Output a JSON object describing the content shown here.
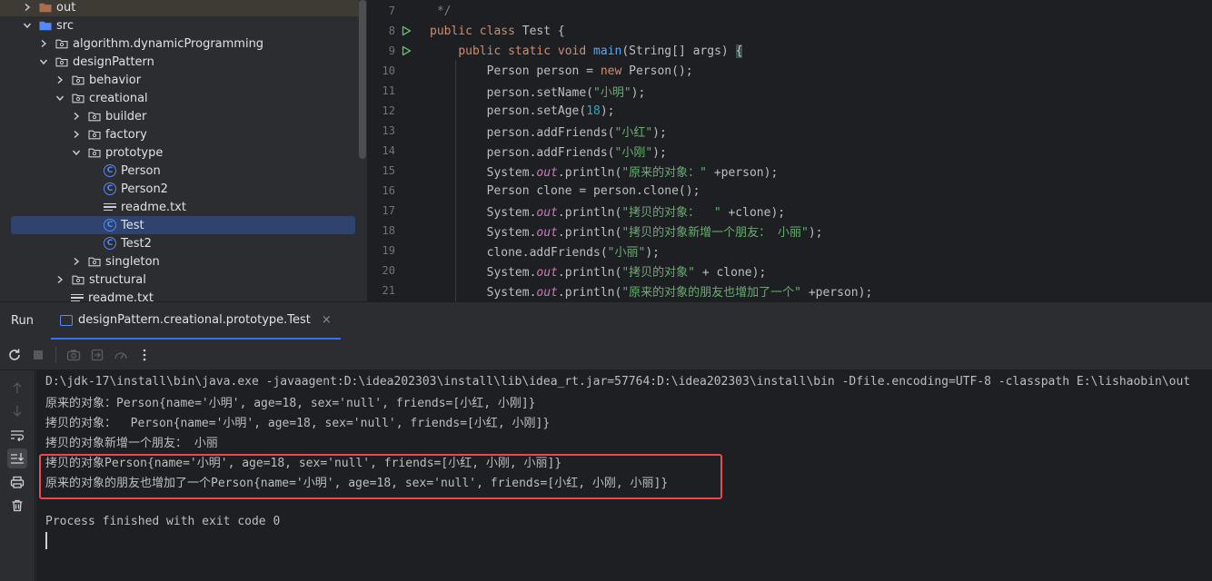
{
  "tree": {
    "items": [
      {
        "label": "out",
        "kind": "folder-brown",
        "expand": "collapsed",
        "depth": 1
      },
      {
        "label": "src",
        "kind": "folder-blue",
        "expand": "expanded",
        "depth": 1
      },
      {
        "label": "algorithm.dynamicProgramming",
        "kind": "package",
        "expand": "collapsed",
        "depth": 2
      },
      {
        "label": "designPattern",
        "kind": "package",
        "expand": "expanded",
        "depth": 2
      },
      {
        "label": "behavior",
        "kind": "package",
        "expand": "collapsed",
        "depth": 3
      },
      {
        "label": "creational",
        "kind": "package",
        "expand": "expanded",
        "depth": 3
      },
      {
        "label": "builder",
        "kind": "package",
        "expand": "collapsed",
        "depth": 4
      },
      {
        "label": "factory",
        "kind": "package",
        "expand": "collapsed",
        "depth": 4
      },
      {
        "label": "prototype",
        "kind": "package",
        "expand": "expanded",
        "depth": 4
      },
      {
        "label": "Person",
        "kind": "class",
        "expand": "none",
        "depth": 5
      },
      {
        "label": "Person2",
        "kind": "class",
        "expand": "none",
        "depth": 5
      },
      {
        "label": "readme.txt",
        "kind": "text",
        "expand": "none",
        "depth": 5
      },
      {
        "label": "Test",
        "kind": "class",
        "expand": "none",
        "depth": 5,
        "selected": true
      },
      {
        "label": "Test2",
        "kind": "class",
        "expand": "none",
        "depth": 5
      },
      {
        "label": "singleton",
        "kind": "package",
        "expand": "collapsed",
        "depth": 4
      },
      {
        "label": "structural",
        "kind": "package",
        "expand": "collapsed",
        "depth": 3
      },
      {
        "label": "readme.txt",
        "kind": "text",
        "expand": "none",
        "depth": 3
      }
    ]
  },
  "editor": {
    "lines": [
      {
        "n": "7",
        "run": false,
        "tokens": [
          [
            "cm",
            " */"
          ]
        ]
      },
      {
        "n": "8",
        "run": true,
        "tokens": [
          [
            "kw",
            "public class "
          ],
          [
            "code",
            "Test {"
          ]
        ]
      },
      {
        "n": "9",
        "run": true,
        "tokens": [
          [
            "code",
            "    "
          ],
          [
            "kw",
            "public static void "
          ],
          [
            "fn",
            "main"
          ],
          [
            "code",
            "(String[] args) "
          ],
          [
            "bracket",
            "{"
          ]
        ]
      },
      {
        "n": "10",
        "run": false,
        "tokens": [
          [
            "code",
            "        Person person = "
          ],
          [
            "kw",
            "new "
          ],
          [
            "code",
            "Person();"
          ]
        ]
      },
      {
        "n": "11",
        "run": false,
        "tokens": [
          [
            "code",
            "        person.setName("
          ],
          [
            "str",
            "\"小明\""
          ],
          [
            "code",
            ");"
          ]
        ]
      },
      {
        "n": "12",
        "run": false,
        "tokens": [
          [
            "code",
            "        person.setAge("
          ],
          [
            "num",
            "18"
          ],
          [
            "code",
            ");"
          ]
        ]
      },
      {
        "n": "13",
        "run": false,
        "tokens": [
          [
            "code",
            "        person.addFriends("
          ],
          [
            "str",
            "\"小红\""
          ],
          [
            "code",
            ");"
          ]
        ]
      },
      {
        "n": "14",
        "run": false,
        "tokens": [
          [
            "code",
            "        person.addFriends("
          ],
          [
            "str",
            "\"小刚\""
          ],
          [
            "code",
            ");"
          ]
        ]
      },
      {
        "n": "15",
        "run": false,
        "tokens": [
          [
            "code",
            "        System."
          ],
          [
            "it",
            "out"
          ],
          [
            "code",
            ".println("
          ],
          [
            "str",
            "\"原来的对象：\" "
          ],
          [
            "code",
            "+person);"
          ]
        ]
      },
      {
        "n": "16",
        "run": false,
        "tokens": [
          [
            "code",
            "        Person clone = person.clone();"
          ]
        ]
      },
      {
        "n": "17",
        "run": false,
        "tokens": [
          [
            "code",
            "        System."
          ],
          [
            "it",
            "out"
          ],
          [
            "code",
            ".println("
          ],
          [
            "str",
            "\"拷贝的对象：  \" "
          ],
          [
            "code",
            "+clone);"
          ]
        ]
      },
      {
        "n": "18",
        "run": false,
        "tokens": [
          [
            "code",
            "        System."
          ],
          [
            "it",
            "out"
          ],
          [
            "code",
            ".println("
          ],
          [
            "str",
            "\"拷贝的对象新增一个朋友： 小丽\""
          ],
          [
            "code",
            ");"
          ]
        ]
      },
      {
        "n": "19",
        "run": false,
        "tokens": [
          [
            "code",
            "        clone.addFriends("
          ],
          [
            "str",
            "\"小丽\""
          ],
          [
            "code",
            ");"
          ]
        ]
      },
      {
        "n": "20",
        "run": false,
        "tokens": [
          [
            "code",
            "        System."
          ],
          [
            "it",
            "out"
          ],
          [
            "code",
            ".println("
          ],
          [
            "str",
            "\"拷贝的对象\" "
          ],
          [
            "code",
            "+ clone);"
          ]
        ]
      },
      {
        "n": "21",
        "run": false,
        "tokens": [
          [
            "code",
            "        System."
          ],
          [
            "it",
            "out"
          ],
          [
            "code",
            ".println("
          ],
          [
            "str",
            "\"原来的对象的朋友也增加了一个\" "
          ],
          [
            "code",
            "+person);"
          ]
        ]
      }
    ]
  },
  "run": {
    "title": "Run",
    "tab_label": "designPattern.creational.prototype.Test",
    "tab_close": "×"
  },
  "console": {
    "lines": [
      "D:\\jdk-17\\install\\bin\\java.exe -javaagent:D:\\idea202303\\install\\lib\\idea_rt.jar=57764:D:\\idea202303\\install\\bin -Dfile.encoding=UTF-8 -classpath E:\\lishaobin\\out",
      "原来的对象：Person{name='小明', age=18, sex='null', friends=[小红, 小刚]}",
      "拷贝的对象：  Person{name='小明', age=18, sex='null', friends=[小红, 小刚]}",
      "拷贝的对象新增一个朋友： 小丽",
      "拷贝的对象Person{name='小明', age=18, sex='null', friends=[小红, 小刚, 小丽]}",
      "原来的对象的朋友也增加了一个Person{name='小明', age=18, sex='null', friends=[小红, 小刚, 小丽]}",
      "",
      "Process finished with exit code 0"
    ]
  },
  "colors": {
    "accent": "#3574f0",
    "highlight_box": "#e84a4f",
    "selection": "#2e436e"
  }
}
